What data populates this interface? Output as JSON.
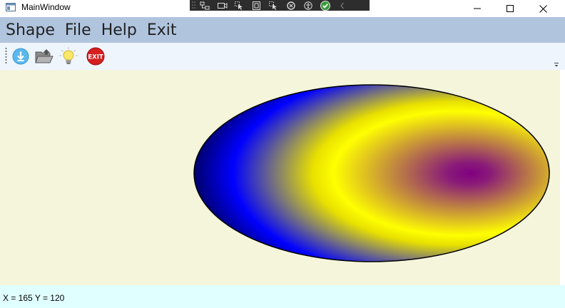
{
  "window": {
    "title": "MainWindow"
  },
  "menu": {
    "items": [
      {
        "label": "Shape"
      },
      {
        "label": "File"
      },
      {
        "label": "Help"
      },
      {
        "label": "Exit"
      }
    ]
  },
  "toolbar": {
    "buttons": [
      {
        "icon": "download-icon"
      },
      {
        "icon": "open-folder-icon"
      },
      {
        "icon": "lightbulb-icon"
      },
      {
        "icon": "exit-icon",
        "text": "EXIT"
      }
    ]
  },
  "canvas": {
    "background": "#f5f5dc",
    "shape": "ellipse",
    "fill": "radial-gradient",
    "gradient_colors": [
      "#800080",
      "#ffff00",
      "#0000ff",
      "#000000"
    ],
    "stroke": "#000000"
  },
  "status": {
    "text": "X = 165 Y = 120"
  },
  "colors": {
    "menubar": "#b0c4de",
    "toolbar": "#eef5fd",
    "statusbar": "#e0ffff"
  }
}
